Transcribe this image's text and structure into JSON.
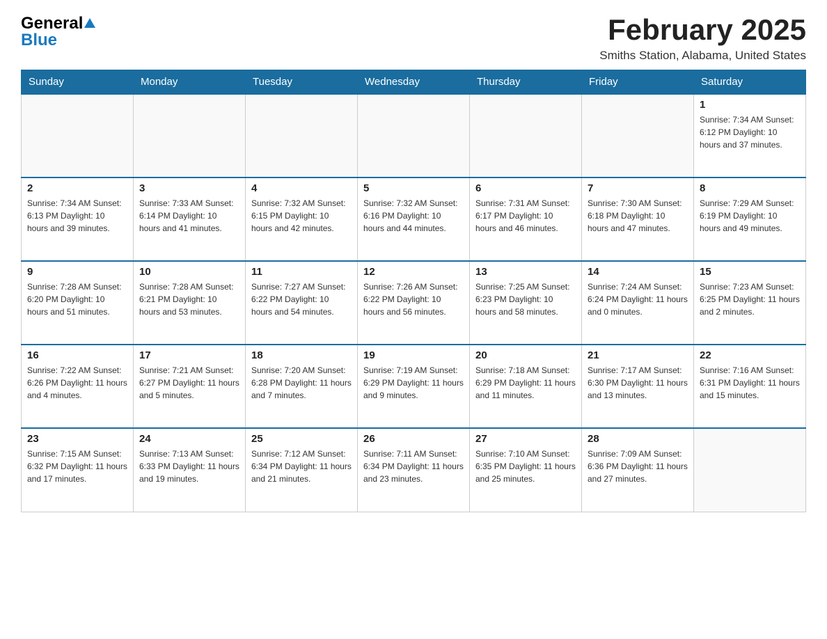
{
  "header": {
    "logo_line1": "General",
    "logo_line2": "Blue",
    "month_title": "February 2025",
    "location": "Smiths Station, Alabama, United States"
  },
  "weekdays": [
    "Sunday",
    "Monday",
    "Tuesday",
    "Wednesday",
    "Thursday",
    "Friday",
    "Saturday"
  ],
  "weeks": [
    [
      {
        "day": "",
        "info": ""
      },
      {
        "day": "",
        "info": ""
      },
      {
        "day": "",
        "info": ""
      },
      {
        "day": "",
        "info": ""
      },
      {
        "day": "",
        "info": ""
      },
      {
        "day": "",
        "info": ""
      },
      {
        "day": "1",
        "info": "Sunrise: 7:34 AM\nSunset: 6:12 PM\nDaylight: 10 hours and 37 minutes."
      }
    ],
    [
      {
        "day": "2",
        "info": "Sunrise: 7:34 AM\nSunset: 6:13 PM\nDaylight: 10 hours and 39 minutes."
      },
      {
        "day": "3",
        "info": "Sunrise: 7:33 AM\nSunset: 6:14 PM\nDaylight: 10 hours and 41 minutes."
      },
      {
        "day": "4",
        "info": "Sunrise: 7:32 AM\nSunset: 6:15 PM\nDaylight: 10 hours and 42 minutes."
      },
      {
        "day": "5",
        "info": "Sunrise: 7:32 AM\nSunset: 6:16 PM\nDaylight: 10 hours and 44 minutes."
      },
      {
        "day": "6",
        "info": "Sunrise: 7:31 AM\nSunset: 6:17 PM\nDaylight: 10 hours and 46 minutes."
      },
      {
        "day": "7",
        "info": "Sunrise: 7:30 AM\nSunset: 6:18 PM\nDaylight: 10 hours and 47 minutes."
      },
      {
        "day": "8",
        "info": "Sunrise: 7:29 AM\nSunset: 6:19 PM\nDaylight: 10 hours and 49 minutes."
      }
    ],
    [
      {
        "day": "9",
        "info": "Sunrise: 7:28 AM\nSunset: 6:20 PM\nDaylight: 10 hours and 51 minutes."
      },
      {
        "day": "10",
        "info": "Sunrise: 7:28 AM\nSunset: 6:21 PM\nDaylight: 10 hours and 53 minutes."
      },
      {
        "day": "11",
        "info": "Sunrise: 7:27 AM\nSunset: 6:22 PM\nDaylight: 10 hours and 54 minutes."
      },
      {
        "day": "12",
        "info": "Sunrise: 7:26 AM\nSunset: 6:22 PM\nDaylight: 10 hours and 56 minutes."
      },
      {
        "day": "13",
        "info": "Sunrise: 7:25 AM\nSunset: 6:23 PM\nDaylight: 10 hours and 58 minutes."
      },
      {
        "day": "14",
        "info": "Sunrise: 7:24 AM\nSunset: 6:24 PM\nDaylight: 11 hours and 0 minutes."
      },
      {
        "day": "15",
        "info": "Sunrise: 7:23 AM\nSunset: 6:25 PM\nDaylight: 11 hours and 2 minutes."
      }
    ],
    [
      {
        "day": "16",
        "info": "Sunrise: 7:22 AM\nSunset: 6:26 PM\nDaylight: 11 hours and 4 minutes."
      },
      {
        "day": "17",
        "info": "Sunrise: 7:21 AM\nSunset: 6:27 PM\nDaylight: 11 hours and 5 minutes."
      },
      {
        "day": "18",
        "info": "Sunrise: 7:20 AM\nSunset: 6:28 PM\nDaylight: 11 hours and 7 minutes."
      },
      {
        "day": "19",
        "info": "Sunrise: 7:19 AM\nSunset: 6:29 PM\nDaylight: 11 hours and 9 minutes."
      },
      {
        "day": "20",
        "info": "Sunrise: 7:18 AM\nSunset: 6:29 PM\nDaylight: 11 hours and 11 minutes."
      },
      {
        "day": "21",
        "info": "Sunrise: 7:17 AM\nSunset: 6:30 PM\nDaylight: 11 hours and 13 minutes."
      },
      {
        "day": "22",
        "info": "Sunrise: 7:16 AM\nSunset: 6:31 PM\nDaylight: 11 hours and 15 minutes."
      }
    ],
    [
      {
        "day": "23",
        "info": "Sunrise: 7:15 AM\nSunset: 6:32 PM\nDaylight: 11 hours and 17 minutes."
      },
      {
        "day": "24",
        "info": "Sunrise: 7:13 AM\nSunset: 6:33 PM\nDaylight: 11 hours and 19 minutes."
      },
      {
        "day": "25",
        "info": "Sunrise: 7:12 AM\nSunset: 6:34 PM\nDaylight: 11 hours and 21 minutes."
      },
      {
        "day": "26",
        "info": "Sunrise: 7:11 AM\nSunset: 6:34 PM\nDaylight: 11 hours and 23 minutes."
      },
      {
        "day": "27",
        "info": "Sunrise: 7:10 AM\nSunset: 6:35 PM\nDaylight: 11 hours and 25 minutes."
      },
      {
        "day": "28",
        "info": "Sunrise: 7:09 AM\nSunset: 6:36 PM\nDaylight: 11 hours and 27 minutes."
      },
      {
        "day": "",
        "info": ""
      }
    ]
  ]
}
